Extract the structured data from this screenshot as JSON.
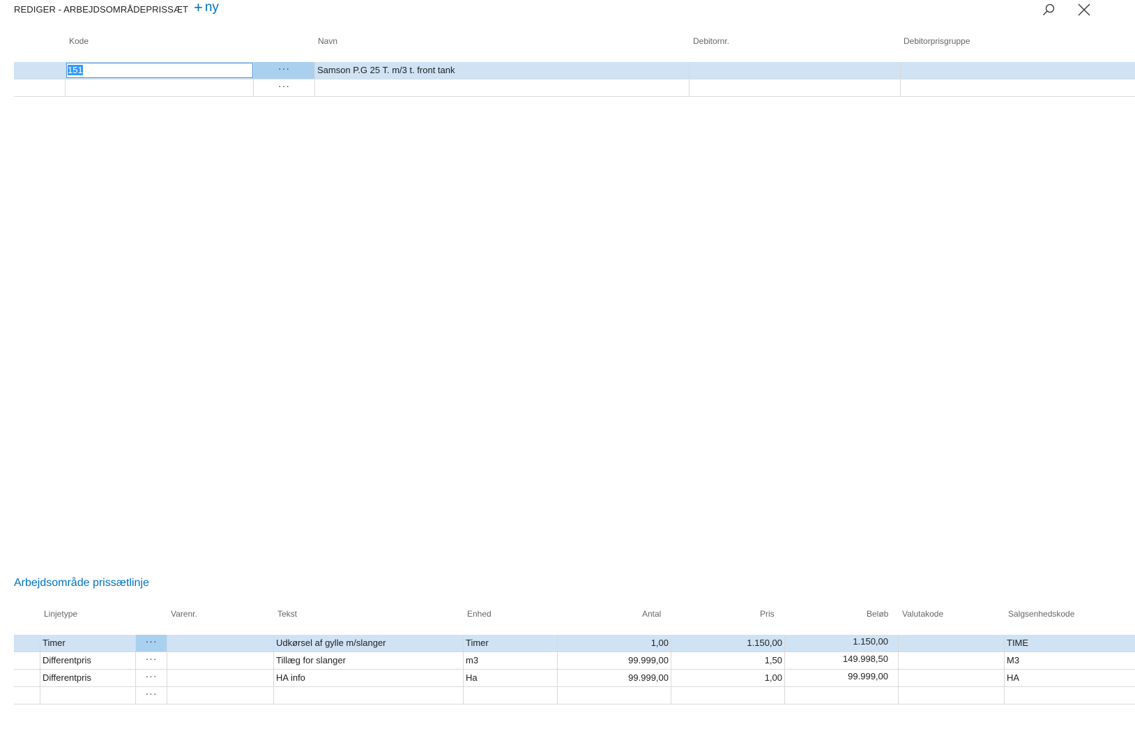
{
  "header": {
    "title": "REDIGER - ARBEJDSOMRÅDEPRISSÆT",
    "new_label": "ny"
  },
  "top_table": {
    "columns": [
      "Kode",
      "Navn",
      "Debitornr.",
      "Debitorprisgruppe"
    ],
    "rows": [
      {
        "kode": "151",
        "navn": "Samson P.G 25 T. m/3 t. front tank",
        "debitornr": "",
        "debitorprisgruppe": ""
      },
      {
        "kode": "",
        "navn": "",
        "debitornr": "",
        "debitorprisgruppe": ""
      }
    ]
  },
  "lines_section": {
    "title": "Arbejdsområde prissætlinje",
    "columns": [
      "Linjetype",
      "Varenr.",
      "Tekst",
      "Enhed",
      "Antal",
      "Pris",
      "Beløb",
      "Valutakode",
      "Salgsenhedskode"
    ],
    "rows": [
      {
        "linjetype": "Timer",
        "varenr": "",
        "tekst": "Udkørsel af gylle m/slanger",
        "enhed": "Timer",
        "antal": "1,00",
        "pris": "1.150,00",
        "belob": "1.150,00",
        "valutakode": "",
        "salgsenhedskode": "TIME"
      },
      {
        "linjetype": "Differentpris",
        "varenr": "",
        "tekst": "Tillæg for slanger",
        "enhed": "m3",
        "antal": "99.999,00",
        "pris": "1,50",
        "belob": "149.998,50",
        "valutakode": "",
        "salgsenhedskode": "M3"
      },
      {
        "linjetype": "Differentpris",
        "varenr": "",
        "tekst": "HA info",
        "enhed": "Ha",
        "antal": "99.999,00",
        "pris": "1,00",
        "belob": "99.999,00",
        "valutakode": "",
        "salgsenhedskode": "HA"
      },
      {
        "linjetype": "",
        "varenr": "",
        "tekst": "",
        "enhed": "",
        "antal": "",
        "pris": "",
        "belob": "",
        "valutakode": "",
        "salgsenhedskode": ""
      }
    ]
  },
  "icons": {
    "new": "plus-icon",
    "search": "search-icon",
    "close": "close-icon",
    "row_menu": "ellipsis-icon"
  },
  "colors": {
    "accent": "#0072c6",
    "selected_row": "#cfe3f5",
    "active_cell": "#a9d0ef"
  }
}
